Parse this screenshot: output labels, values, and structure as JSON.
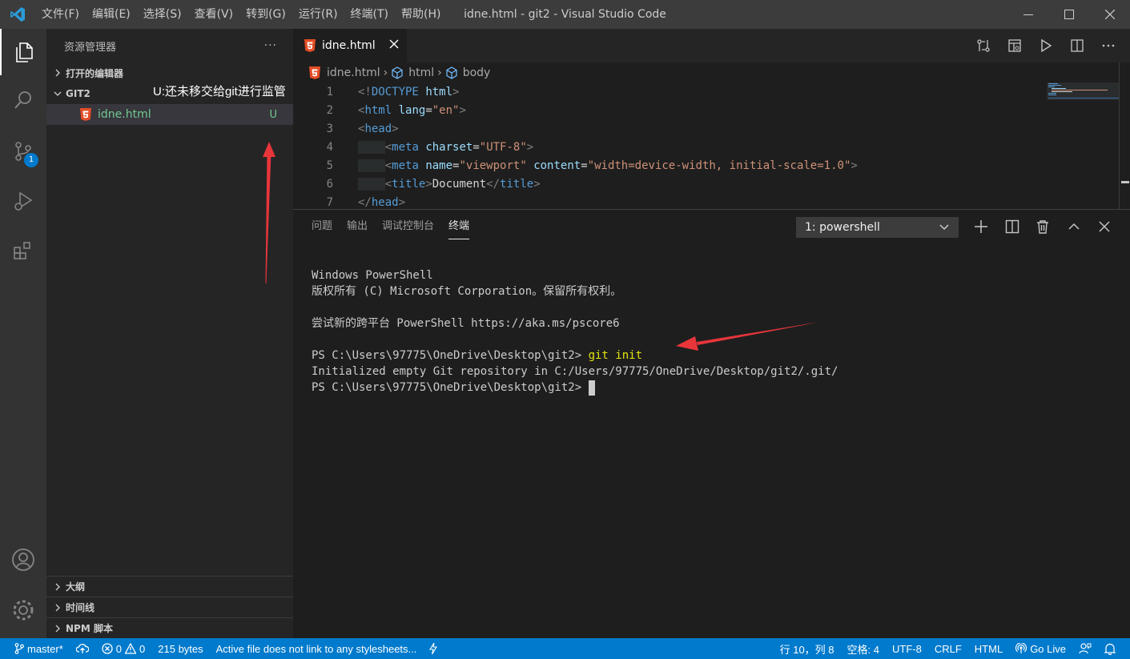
{
  "titlebar": {
    "menus": [
      "文件(F)",
      "编辑(E)",
      "选择(S)",
      "查看(V)",
      "转到(G)",
      "运行(R)",
      "终端(T)",
      "帮助(H)"
    ],
    "window_title": "idne.html - git2 - Visual Studio Code"
  },
  "activitybar": {
    "items": [
      "explorer-icon",
      "search-icon",
      "source-control-icon",
      "run-debug-icon",
      "extensions-icon"
    ],
    "scm_badge": "1",
    "bottom_items": [
      "account-icon",
      "settings-gear-icon"
    ]
  },
  "sidebar": {
    "title": "资源管理器",
    "more": "···",
    "open_editors": "打开的编辑器",
    "folder": "GIT2",
    "file": {
      "name": "idne.html",
      "status": "U"
    },
    "annotation": "U:还未移交给git进行监管",
    "outline": "大纲",
    "timeline": "时间线",
    "npm_scripts": "NPM 脚本"
  },
  "editor": {
    "tab_label": "idne.html",
    "breadcrumb": [
      "idne.html",
      "html",
      "body"
    ],
    "line_numbers": [
      "1",
      "2",
      "3",
      "4",
      "5",
      "6",
      "7"
    ]
  },
  "panel": {
    "tabs": [
      "问题",
      "输出",
      "调试控制台",
      "终端"
    ],
    "active_tab": "终端",
    "shell_select": "1: powershell",
    "terminal": {
      "l1": "Windows PowerShell",
      "l2": "版权所有 (C) Microsoft Corporation。保留所有权利。",
      "l3": "尝试新的跨平台 PowerShell https://aka.ms/pscore6",
      "prompt1": "PS C:\\Users\\97775\\OneDrive\\Desktop\\git2> ",
      "cmd": "git init",
      "l5": "Initialized empty Git repository in C:/Users/97775/OneDrive/Desktop/git2/.git/",
      "prompt2": "PS C:\\Users\\97775\\OneDrive\\Desktop\\git2> "
    }
  },
  "statusbar": {
    "branch": "master*",
    "errors": "0",
    "warnings": "0",
    "size": "215 bytes",
    "message": "Active file does not link to any stylesheets...",
    "position": "行 10，列 8",
    "spaces": "空格: 4",
    "encoding": "UTF-8",
    "eol": "CRLF",
    "language": "HTML",
    "golive": "Go Live"
  },
  "colors": {
    "accent": "#007acc",
    "untracked": "#73c991",
    "annotation_arrow": "#e8353a"
  }
}
